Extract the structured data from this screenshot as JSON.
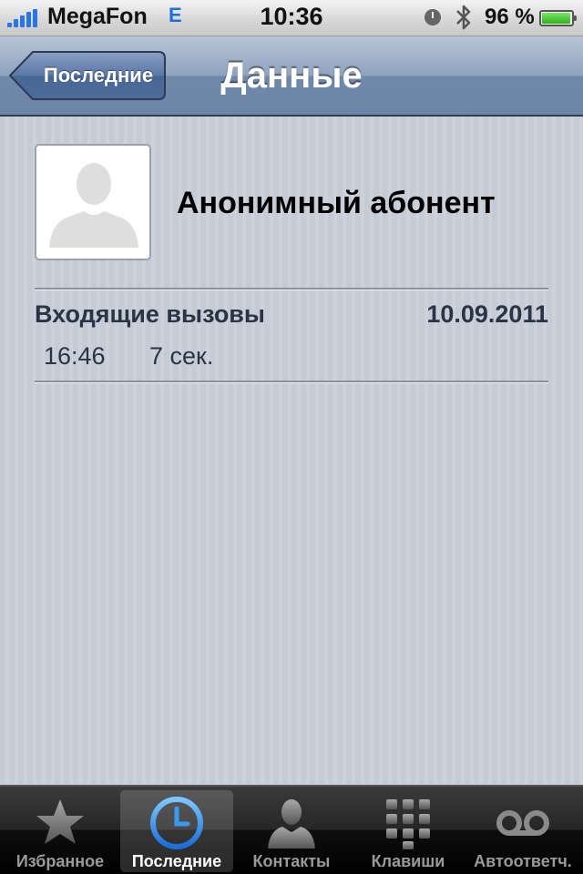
{
  "status_bar": {
    "carrier": "MegaFon",
    "network": "E",
    "time": "10:36",
    "battery_percent": "96 %",
    "battery_level": 0.96,
    "icons": [
      "signal-icon",
      "alarm-clock-icon",
      "bluetooth-icon",
      "battery-icon"
    ]
  },
  "nav": {
    "back_label": "Последние",
    "title": "Данные"
  },
  "contact": {
    "name": "Анонимный абонент",
    "photo_icon": "person-silhouette-icon"
  },
  "calls": {
    "type": "Входящие вызовы",
    "date": "10.09.2011",
    "entries": [
      {
        "time": "16:46",
        "duration": "7 сек."
      }
    ]
  },
  "tabbar": {
    "tabs": [
      {
        "label": "Избранное",
        "icon": "star-icon",
        "active": false
      },
      {
        "label": "Последние",
        "icon": "clock-icon",
        "active": true
      },
      {
        "label": "Контакты",
        "icon": "contact-icon",
        "active": false
      },
      {
        "label": "Клавиши",
        "icon": "keypad-icon",
        "active": false
      },
      {
        "label": "Автоответч.",
        "icon": "voicemail-icon",
        "active": false
      }
    ]
  },
  "colors": {
    "accent_blue": "#2876e6",
    "nav_bar": "#6d85a7",
    "battery_green": "#2fb21b"
  }
}
